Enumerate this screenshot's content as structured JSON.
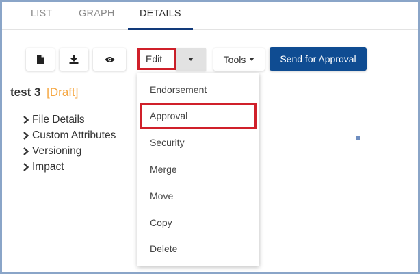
{
  "tabs": [
    {
      "label": "LIST",
      "active": false
    },
    {
      "label": "GRAPH",
      "active": false
    },
    {
      "label": "DETAILS",
      "active": true
    }
  ],
  "toolbar": {
    "icons": [
      "document-icon",
      "download-icon",
      "eye-icon"
    ],
    "edit_label": "Edit",
    "tools_label": "Tools",
    "send_label": "Send for Approval"
  },
  "item": {
    "name": "test 3",
    "status": "[Draft]"
  },
  "tree": [
    {
      "label": "File Details"
    },
    {
      "label": "Custom Attributes"
    },
    {
      "label": "Versioning"
    },
    {
      "label": "Impact"
    }
  ],
  "menu": [
    {
      "label": "Endorsement"
    },
    {
      "label": "Approval",
      "highlighted": true
    },
    {
      "label": "Security"
    },
    {
      "label": "Merge"
    },
    {
      "label": "Move"
    },
    {
      "label": "Copy"
    },
    {
      "label": "Delete"
    }
  ],
  "colors": {
    "accent": "#0f4c92",
    "tab_underline": "#123a7a",
    "draft": "#f5a640",
    "highlight_border": "#d0202a"
  }
}
